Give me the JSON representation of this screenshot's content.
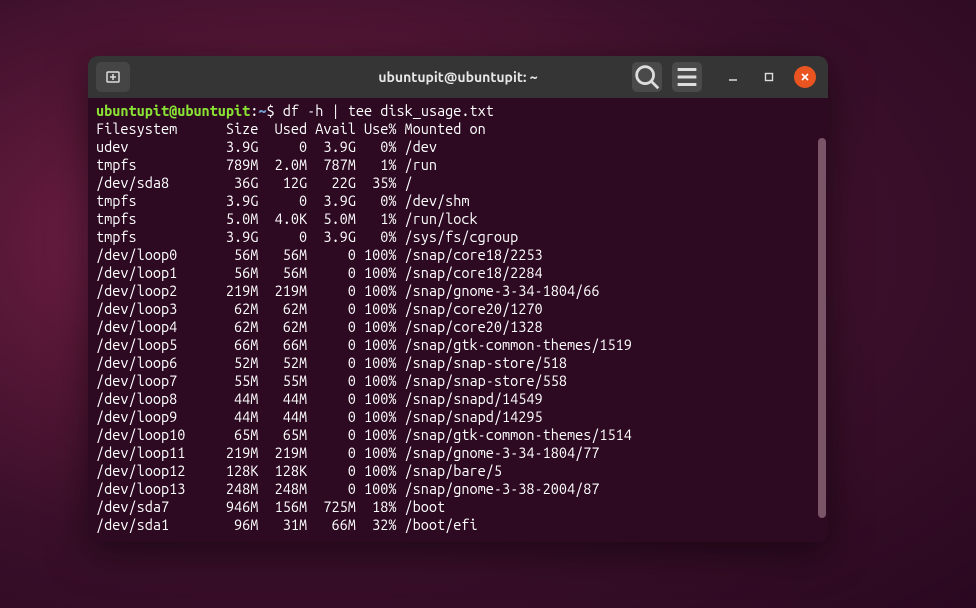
{
  "window": {
    "title": "ubuntupit@ubuntupit: ~"
  },
  "prompt": {
    "user_host": "ubuntupit@ubuntupit",
    "sep1": ":",
    "path": "~",
    "sep2": "$",
    "command": "df -h | tee disk_usage.txt"
  },
  "header": "Filesystem      Size  Used Avail Use% Mounted on",
  "rows": [
    {
      "fs": "udev",
      "size": "3.9G",
      "used": "0",
      "avail": "3.9G",
      "use": "0%",
      "mount": "/dev"
    },
    {
      "fs": "tmpfs",
      "size": "789M",
      "used": "2.0M",
      "avail": "787M",
      "use": "1%",
      "mount": "/run"
    },
    {
      "fs": "/dev/sda8",
      "size": "36G",
      "used": "12G",
      "avail": "22G",
      "use": "35%",
      "mount": "/"
    },
    {
      "fs": "tmpfs",
      "size": "3.9G",
      "used": "0",
      "avail": "3.9G",
      "use": "0%",
      "mount": "/dev/shm"
    },
    {
      "fs": "tmpfs",
      "size": "5.0M",
      "used": "4.0K",
      "avail": "5.0M",
      "use": "1%",
      "mount": "/run/lock"
    },
    {
      "fs": "tmpfs",
      "size": "3.9G",
      "used": "0",
      "avail": "3.9G",
      "use": "0%",
      "mount": "/sys/fs/cgroup"
    },
    {
      "fs": "/dev/loop0",
      "size": "56M",
      "used": "56M",
      "avail": "0",
      "use": "100%",
      "mount": "/snap/core18/2253"
    },
    {
      "fs": "/dev/loop1",
      "size": "56M",
      "used": "56M",
      "avail": "0",
      "use": "100%",
      "mount": "/snap/core18/2284"
    },
    {
      "fs": "/dev/loop2",
      "size": "219M",
      "used": "219M",
      "avail": "0",
      "use": "100%",
      "mount": "/snap/gnome-3-34-1804/66"
    },
    {
      "fs": "/dev/loop3",
      "size": "62M",
      "used": "62M",
      "avail": "0",
      "use": "100%",
      "mount": "/snap/core20/1270"
    },
    {
      "fs": "/dev/loop4",
      "size": "62M",
      "used": "62M",
      "avail": "0",
      "use": "100%",
      "mount": "/snap/core20/1328"
    },
    {
      "fs": "/dev/loop5",
      "size": "66M",
      "used": "66M",
      "avail": "0",
      "use": "100%",
      "mount": "/snap/gtk-common-themes/1519"
    },
    {
      "fs": "/dev/loop6",
      "size": "52M",
      "used": "52M",
      "avail": "0",
      "use": "100%",
      "mount": "/snap/snap-store/518"
    },
    {
      "fs": "/dev/loop7",
      "size": "55M",
      "used": "55M",
      "avail": "0",
      "use": "100%",
      "mount": "/snap/snap-store/558"
    },
    {
      "fs": "/dev/loop8",
      "size": "44M",
      "used": "44M",
      "avail": "0",
      "use": "100%",
      "mount": "/snap/snapd/14549"
    },
    {
      "fs": "/dev/loop9",
      "size": "44M",
      "used": "44M",
      "avail": "0",
      "use": "100%",
      "mount": "/snap/snapd/14295"
    },
    {
      "fs": "/dev/loop10",
      "size": "65M",
      "used": "65M",
      "avail": "0",
      "use": "100%",
      "mount": "/snap/gtk-common-themes/1514"
    },
    {
      "fs": "/dev/loop11",
      "size": "219M",
      "used": "219M",
      "avail": "0",
      "use": "100%",
      "mount": "/snap/gnome-3-34-1804/77"
    },
    {
      "fs": "/dev/loop12",
      "size": "128K",
      "used": "128K",
      "avail": "0",
      "use": "100%",
      "mount": "/snap/bare/5"
    },
    {
      "fs": "/dev/loop13",
      "size": "248M",
      "used": "248M",
      "avail": "0",
      "use": "100%",
      "mount": "/snap/gnome-3-38-2004/87"
    },
    {
      "fs": "/dev/sda7",
      "size": "946M",
      "used": "156M",
      "avail": "725M",
      "use": "18%",
      "mount": "/boot"
    },
    {
      "fs": "/dev/sda1",
      "size": "96M",
      "used": "31M",
      "avail": "66M",
      "use": "32%",
      "mount": "/boot/efi"
    }
  ]
}
